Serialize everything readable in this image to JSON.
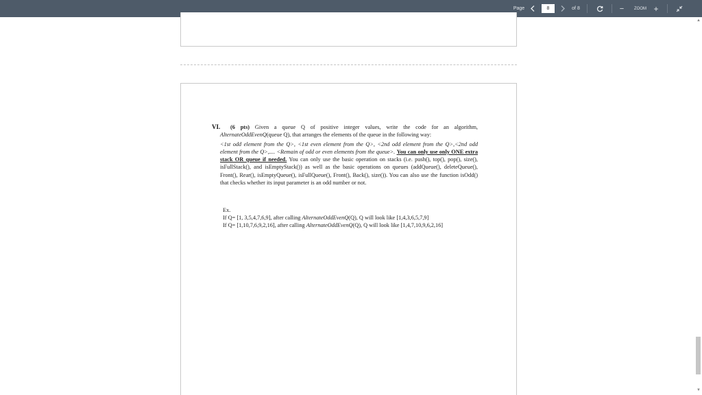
{
  "toolbar": {
    "page_label": "Page",
    "prev_icon": "chevron-left-icon",
    "current_page": "8",
    "next_icon": "chevron-right-icon",
    "of_pages": "of 8",
    "refresh_icon": "refresh-icon",
    "zoom_out": "−",
    "zoom_label": "ZOOM",
    "zoom_in": "+",
    "fit_icon": "collapse-arrows-icon"
  },
  "scrollbar": {
    "up": "▲",
    "down": "▼"
  },
  "document": {
    "question_number": "VI.",
    "points": "(6 pts)",
    "intro": " Given a queue Q of positive integer values, write the code for an algorithm, ",
    "function_name": "AlternateOddEvenQ",
    "function_args": "(queue Q), that arranges the elements of the queue in the following way:",
    "pattern": "<1st odd element from the Q>, <1st even element from the Q>, <2nd odd element from the Q>,<2nd odd element from the Q>,.... <Remain of odd or even elements from the queue>.",
    "constraint_1": "You can only use only ONE extra stack OR queue if needed.",
    "operations": " You can only use the basic operation on stacks (i.e. push(), top(), pop(), size(), isFullStack(), and isEmptyStack()) as well as the basic operations on queues (addQueue(), deleteQueue(), Front(), Rear(), isEmptyQueue(), isFullQueue(), Front(), Back(), size()). You can also use the function isOdd() that checks whether its input parameter is an odd number or not.",
    "example_label": "Ex.",
    "ex1_pre": "If Q= [1, 3,5,4,7,6,9], after calling ",
    "ex1_fn": "AlternateOddEvenQ",
    "ex1_post": "(Q), Q will look like [1,4,3,6,5,7,9]",
    "ex2_pre": "If Q= [1,10,7,6,9,2,16], after calling ",
    "ex2_fn": "AlternateOddEvenQ",
    "ex2_post": "(Q), Q will look like [1,4,7,10,9,6,2,16]"
  }
}
